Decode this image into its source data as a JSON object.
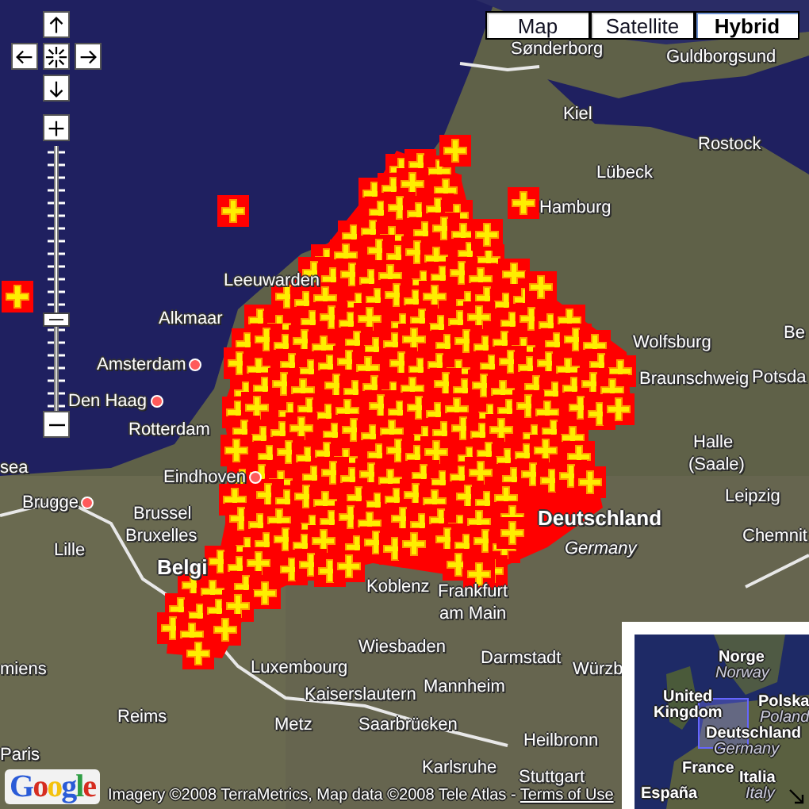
{
  "map_type_buttons": [
    {
      "label": "Map",
      "selected": false
    },
    {
      "label": "Satellite",
      "selected": false
    },
    {
      "label": "Hybrid",
      "selected": true
    }
  ],
  "zoom_slider": {
    "level": 0.35
  },
  "map_labels": [
    {
      "text": "Sønderborg",
      "kind": "place"
    },
    {
      "text": "Guldborgsund",
      "kind": "place"
    },
    {
      "text": "Kiel",
      "kind": "place"
    },
    {
      "text": "Rostock",
      "kind": "place"
    },
    {
      "text": "Lübeck",
      "kind": "place"
    },
    {
      "text": "Hamburg",
      "kind": "place"
    },
    {
      "text": "Leeuwarden",
      "kind": "place"
    },
    {
      "text": "Alkmaar",
      "kind": "place"
    },
    {
      "text": "Amsterdam",
      "kind": "place"
    },
    {
      "text": "Den Haag",
      "kind": "place"
    },
    {
      "text": "Rotterdam",
      "kind": "place"
    },
    {
      "text": "Eindhoven",
      "kind": "place"
    },
    {
      "text": "sea",
      "kind": "place"
    },
    {
      "text": "Brugge",
      "kind": "place"
    },
    {
      "text": "Brussel",
      "kind": "place"
    },
    {
      "text": "Bruxelles",
      "kind": "place"
    },
    {
      "text": "Lille",
      "kind": "place"
    },
    {
      "text": "Belgi",
      "kind": "country"
    },
    {
      "text": "Wiesbaden",
      "kind": "place"
    },
    {
      "text": "Luxembourg",
      "kind": "place"
    },
    {
      "text": "Kaiserslautern",
      "kind": "place"
    },
    {
      "text": "miens",
      "kind": "place"
    },
    {
      "text": "Reims",
      "kind": "place"
    },
    {
      "text": "Metz",
      "kind": "place"
    },
    {
      "text": "Saarbrücken",
      "kind": "place"
    },
    {
      "text": "Paris",
      "kind": "place"
    },
    {
      "text": "Koblenz",
      "kind": "place"
    },
    {
      "text": "Frankfurt",
      "kind": "place"
    },
    {
      "text": "am Main",
      "kind": "place"
    },
    {
      "text": "Darmstadt",
      "kind": "place"
    },
    {
      "text": "Würzb",
      "kind": "place"
    },
    {
      "text": "Mannheim",
      "kind": "place"
    },
    {
      "text": "Heilbronn",
      "kind": "place"
    },
    {
      "text": "Karlsruhe",
      "kind": "place"
    },
    {
      "text": "Stuttgart",
      "kind": "place"
    },
    {
      "text": "Wolfsburg",
      "kind": "place"
    },
    {
      "text": "Braunschweig",
      "kind": "place"
    },
    {
      "text": "Be",
      "kind": "place"
    },
    {
      "text": "Potsda",
      "kind": "place"
    },
    {
      "text": "Halle",
      "kind": "place"
    },
    {
      "text": "(Saale)",
      "kind": "place"
    },
    {
      "text": "Leipzig",
      "kind": "place"
    },
    {
      "text": "Chemnit",
      "kind": "place"
    },
    {
      "text": "Deutschland",
      "kind": "country"
    },
    {
      "text": "Germany",
      "kind": "country_name"
    }
  ],
  "overview_map": {
    "labels": [
      {
        "text": "Norge",
        "kind": "country"
      },
      {
        "text": "Norway",
        "kind": "country_name"
      },
      {
        "text": "United",
        "kind": "country"
      },
      {
        "text": "Kingdom",
        "kind": "country"
      },
      {
        "text": "Polska",
        "kind": "country"
      },
      {
        "text": "Poland",
        "kind": "country_name"
      },
      {
        "text": "Deutschland",
        "kind": "country"
      },
      {
        "text": "Germany",
        "kind": "country_name"
      },
      {
        "text": "France",
        "kind": "country"
      },
      {
        "text": "Italia",
        "kind": "country"
      },
      {
        "text": "España",
        "kind": "country"
      },
      {
        "text": "Italy",
        "kind": "country_name"
      }
    ]
  },
  "logo": "Google",
  "attribution": {
    "text": "Imagery ©2008 TerraMetrics, Map data ©2008 Tele Atlas - ",
    "link": "Terms of Use"
  }
}
